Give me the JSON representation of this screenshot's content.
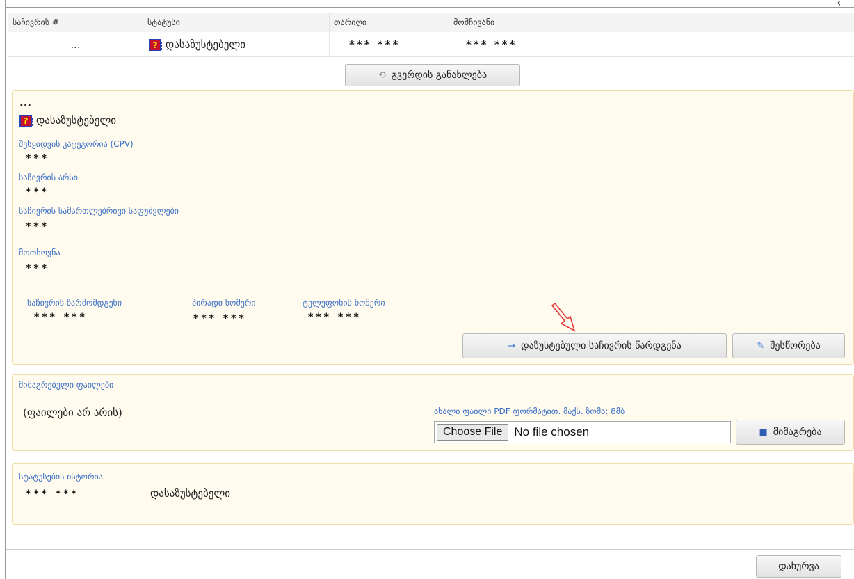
{
  "table": {
    "headers": [
      "საჩივრის #",
      "სტატუსი",
      "თარიღი",
      "მომჩივანი"
    ],
    "row": {
      "number": "...",
      "status": "დასაზუსტებელი",
      "date": "*** ***",
      "complainant": "*** ***"
    }
  },
  "refresh_button": {
    "label": "გვერდის განახლება",
    "icon": "refresh-icon"
  },
  "details": {
    "number": "...",
    "status": "დასაზუსტებელი",
    "cpv_label": "შესყიდვის კატეგორია (CPV)",
    "cpv_value": "***",
    "essence_label": "საჩივრის არსი",
    "essence_value": "***",
    "legal_label": "საჩივრის სამართლებრივი საფუძვლები",
    "legal_value": "***",
    "request_label": "მოთხოვნა",
    "request_value": "***",
    "representative_label": "საჩივრის წარმომდგენი",
    "representative_value": "*** ***",
    "personal_id_label": "პირადი ნომერი",
    "personal_id_value": "*** ***",
    "phone_label": "ტელეფონის ნომერი",
    "phone_value": "*** ***",
    "submit_button": "დაზუსტებული საჩივრის წარდგენა",
    "edit_button": "შესწორება"
  },
  "files": {
    "title": "მიმაგრებული ფაილები",
    "empty": "(ფაილები არ არის)",
    "new_file_label": "ახალი ფაილი PDF ფორმატით. მაქს. ზომა: 8მბ",
    "choose_file": "Choose File",
    "no_file": "No file chosen",
    "attach_button": "მიმაგრება"
  },
  "history": {
    "title": "სტატუსების ისტორია",
    "date": "*** ***",
    "status": "დასაზუსტებელი"
  },
  "close_button": "დახურვა",
  "colors": {
    "label_blue": "#3b6fc4",
    "panel_bg": "#fffbef",
    "panel_border": "#f0dea6",
    "annotation_red": "#e53935"
  }
}
